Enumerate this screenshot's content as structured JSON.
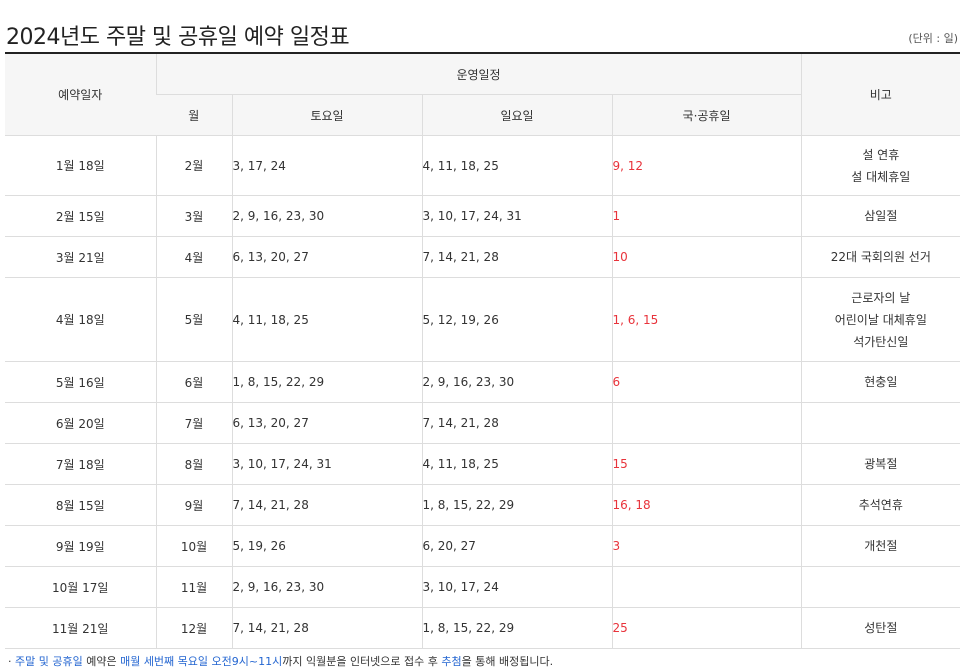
{
  "page": {
    "title": "2024년도 주말 및 공휴일 예약 일정표",
    "unit_note": "(단위 : 일)"
  },
  "table": {
    "headers": {
      "reserve_date": "예약일자",
      "operation_schedule": "운영일정",
      "note": "비고",
      "month": "월",
      "saturday": "토요일",
      "sunday": "일요일",
      "holiday": "국·공휴일"
    },
    "rows": [
      {
        "reserve_date": "1월 18일",
        "month": "2월",
        "saturday": "3, 17, 24",
        "sunday": "4, 11, 18, 25",
        "holiday": "9, 12",
        "notes": [
          "설 연휴",
          "설 대체휴일"
        ]
      },
      {
        "reserve_date": "2월 15일",
        "month": "3월",
        "saturday": "2, 9, 16, 23, 30",
        "sunday": "3, 10, 17, 24, 31",
        "holiday": "1",
        "notes": [
          "삼일절"
        ]
      },
      {
        "reserve_date": "3월 21일",
        "month": "4월",
        "saturday": "6, 13, 20, 27",
        "sunday": "7, 14, 21, 28",
        "holiday": "10",
        "notes": [
          "22대 국회의원 선거"
        ]
      },
      {
        "reserve_date": "4월 18일",
        "month": "5월",
        "saturday": "4, 11, 18, 25",
        "sunday": "5, 12, 19, 26",
        "holiday": "1, 6, 15",
        "notes": [
          "근로자의 날",
          "어린이날 대체휴일",
          "석가탄신일"
        ]
      },
      {
        "reserve_date": "5월 16일",
        "month": "6월",
        "saturday": "1, 8, 15, 22, 29",
        "sunday": "2, 9, 16, 23, 30",
        "holiday": "6",
        "notes": [
          "현충일"
        ]
      },
      {
        "reserve_date": "6월 20일",
        "month": "7월",
        "saturday": "6, 13, 20, 27",
        "sunday": "7, 14, 21, 28",
        "holiday": "",
        "notes": []
      },
      {
        "reserve_date": "7월 18일",
        "month": "8월",
        "saturday": "3, 10, 17, 24, 31",
        "sunday": "4, 11, 18, 25",
        "holiday": "15",
        "notes": [
          "광복절"
        ]
      },
      {
        "reserve_date": "8월 15일",
        "month": "9월",
        "saturday": "7, 14, 21, 28",
        "sunday": "1, 8, 15, 22, 29",
        "holiday": "16, 18",
        "notes": [
          "추석연휴"
        ]
      },
      {
        "reserve_date": "9월 19일",
        "month": "10월",
        "saturday": "5, 19, 26",
        "sunday": "6, 20, 27",
        "holiday": "3",
        "notes": [
          "개천절"
        ]
      },
      {
        "reserve_date": "10월 17일",
        "month": "11월",
        "saturday": "2, 9, 16, 23, 30",
        "sunday": "3, 10, 17, 24",
        "holiday": "",
        "notes": []
      },
      {
        "reserve_date": "11월 21일",
        "month": "12월",
        "saturday": "7, 14, 21, 28",
        "sunday": "1, 8, 15, 22, 29",
        "holiday": "25",
        "notes": [
          "성탄절"
        ]
      }
    ]
  },
  "footnote": {
    "bullet": "·",
    "p1": "주말 및 공휴일",
    "p2": " 예약은 ",
    "p3": "매월 세번째 목요일 오전9시~11시",
    "p4": "까지 익월분을 인터넷으로 접수 후 ",
    "p5": "추첨",
    "p6": "을 통해 배정됩니다."
  },
  "colors": {
    "saturday": "#2466d1",
    "sunday": "#e8333b",
    "holiday": "#e8333b",
    "header_bg": "#f6f6f6",
    "highlight": "#2466d1"
  }
}
